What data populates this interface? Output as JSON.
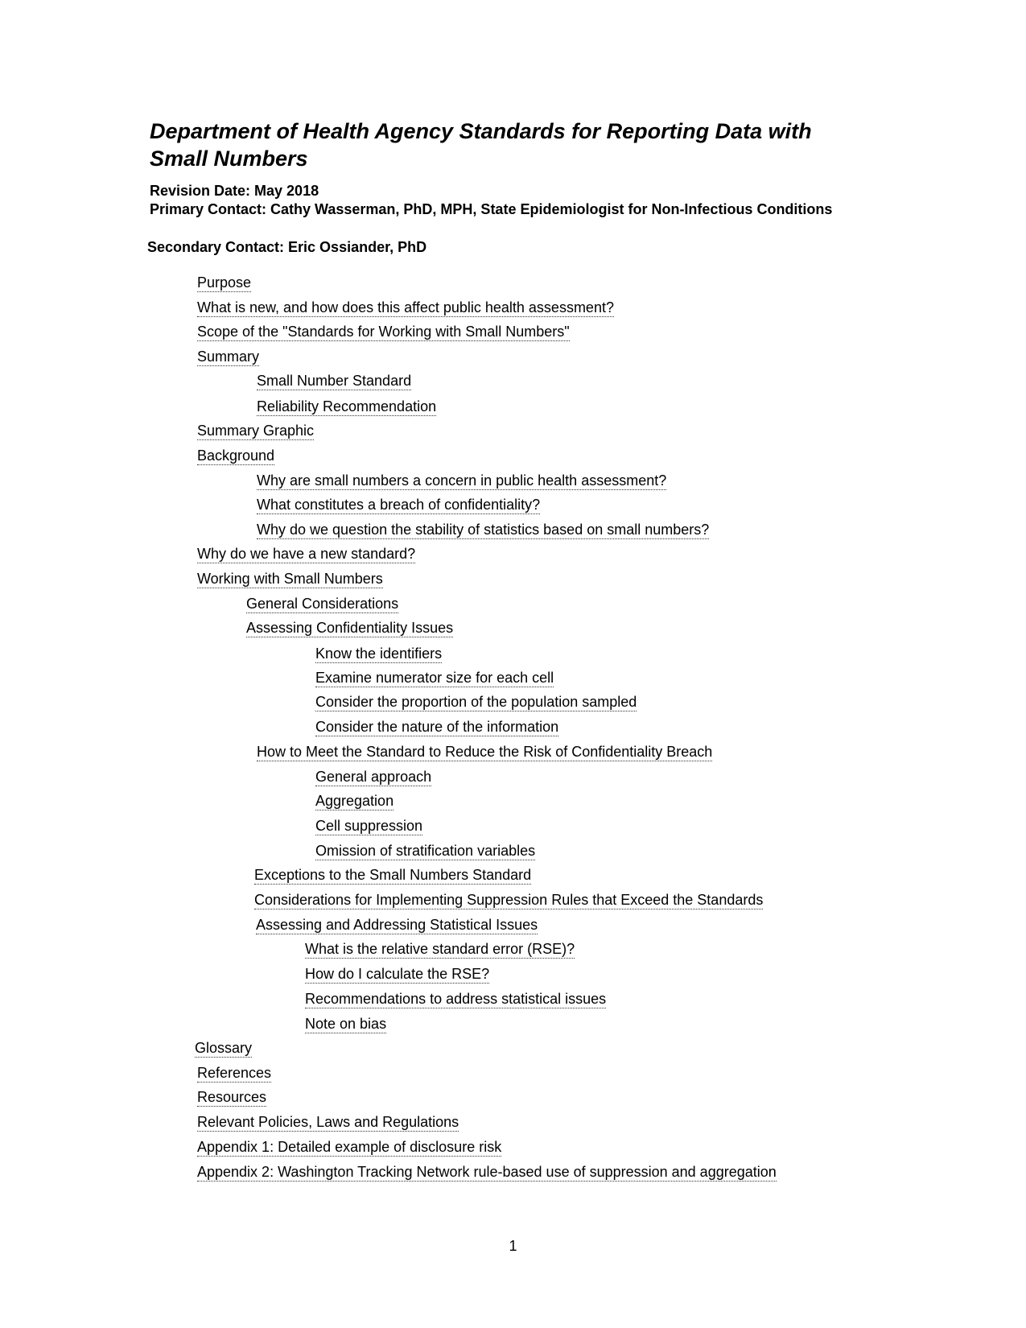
{
  "document": {
    "title": "Department of Health Agency Standards for Reporting Data with Small Numbers",
    "revision": "Revision Date: May 2018",
    "primary_contact": "Primary Contact: Cathy Wasserman, PhD, MPH, State Epidemiologist for Non-Infectious Conditions",
    "secondary_contact": "Secondary Contact: Eric Ossiander, PhD",
    "page_number": "1"
  },
  "toc": [
    {
      "label": "Purpose",
      "level": 0
    },
    {
      "label": "What is new, and how does this affect public health assessment?",
      "level": 0
    },
    {
      "label": "Scope of the \"Standards for Working with Small Numbers\"",
      "level": 0
    },
    {
      "label": "Summary",
      "level": 0
    },
    {
      "label": "Small Number Standard",
      "level": 1
    },
    {
      "label": "Reliability Recommendation",
      "level": 1
    },
    {
      "label": "Summary Graphic",
      "level": 0
    },
    {
      "label": "Background",
      "level": 0
    },
    {
      "label": "Why are small numbers a concern in public health assessment?",
      "level": 1
    },
    {
      "label": "What constitutes a breach of confidentiality?",
      "level": 1
    },
    {
      "label": "Why do we question the stability of statistics based on small numbers?",
      "level": 1
    },
    {
      "label": "Why do we have a new standard?",
      "level": 0
    },
    {
      "label": "Working with Small Numbers",
      "level": 0
    },
    {
      "label": "General Considerations",
      "level": 1
    },
    {
      "label": "Assessing Confidentiality Issues",
      "level": 1
    },
    {
      "label": "Know the identifiers",
      "level": 2
    },
    {
      "label": "Examine numerator size for each cell",
      "level": 2
    },
    {
      "label": "Consider the proportion of the population sampled",
      "level": 2
    },
    {
      "label": "Consider the nature of the information",
      "level": 2
    },
    {
      "label": "How to Meet the Standard to Reduce the Risk of Confidentiality Breach",
      "level": 1
    },
    {
      "label": "General approach",
      "level": 2
    },
    {
      "label": "Aggregation",
      "level": 2
    },
    {
      "label": "Cell suppression",
      "level": 2
    },
    {
      "label": "Omission of stratification variables",
      "level": 2
    },
    {
      "label": "Exceptions to the Small Numbers Standard",
      "level": 1
    },
    {
      "label": "Considerations for Implementing Suppression Rules that Exceed the Standards",
      "level": 1
    },
    {
      "label": "Assessing and Addressing Statistical Issues",
      "level": 1
    },
    {
      "label": "What is the relative standard error (RSE)?",
      "level": 2
    },
    {
      "label": "How do I calculate the RSE?",
      "level": 2
    },
    {
      "label": "Recommendations to address statistical issues",
      "level": 2
    },
    {
      "label": "Note on bias",
      "level": 2
    },
    {
      "label": "Glossary",
      "level": 0
    },
    {
      "label": "References",
      "level": 0
    },
    {
      "label": "Resources",
      "level": 0
    },
    {
      "label": "Relevant Policies, Laws and Regulations",
      "level": 0
    },
    {
      "label": "Appendix 1: Detailed example of disclosure risk",
      "level": 0
    },
    {
      "label": "Appendix 2: Washington Tracking Network rule-based use of suppression and aggregation",
      "level": 0
    }
  ]
}
